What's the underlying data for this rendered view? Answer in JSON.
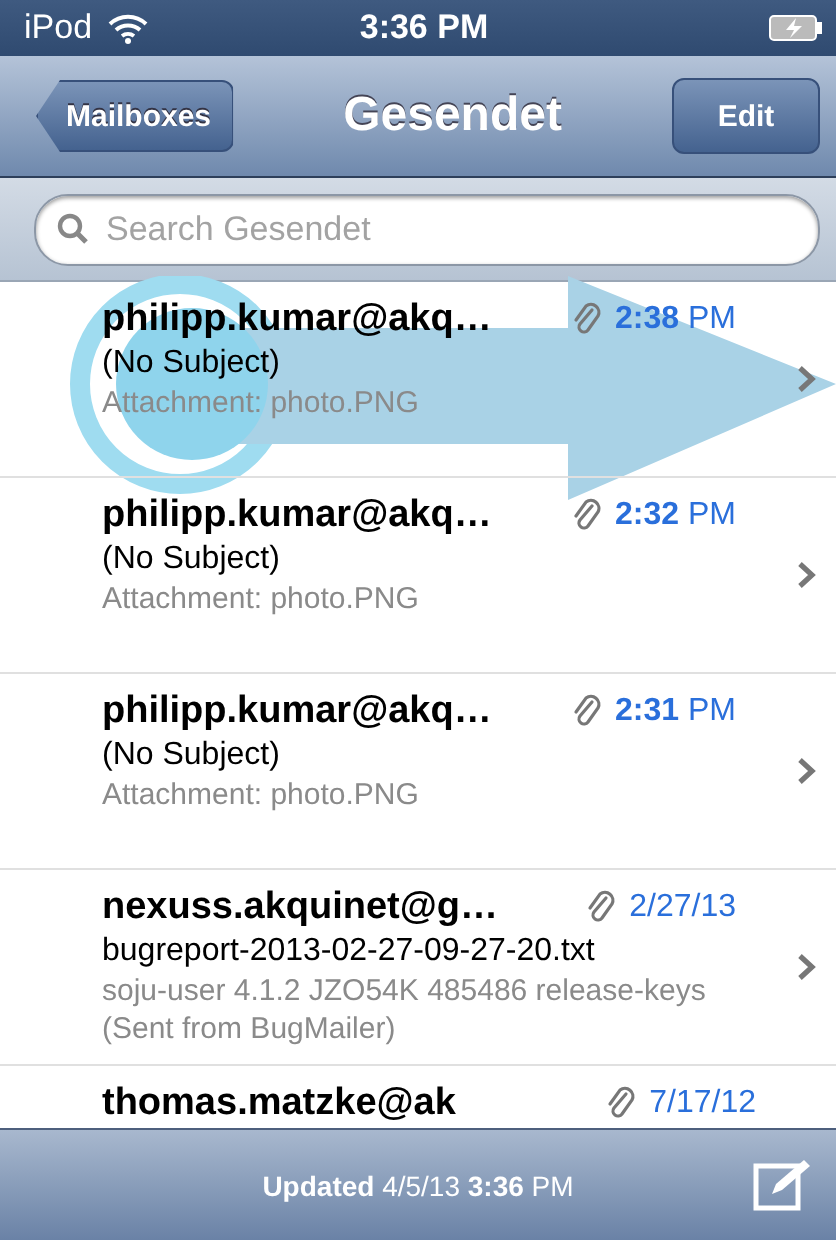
{
  "status_bar": {
    "carrier": "iPod",
    "time": "3:36 PM"
  },
  "nav_bar": {
    "back": "Mailboxes",
    "title": "Gesendet",
    "edit": "Edit"
  },
  "search": {
    "placeholder": "Search Gesendet"
  },
  "messages": [
    {
      "sender": "philipp.kumar@akq…",
      "attachment": true,
      "date": "**2:38** PM",
      "subject": "(No Subject)",
      "preview": "Attachment: photo.PNG"
    },
    {
      "sender": "philipp.kumar@akq…",
      "attachment": true,
      "date": "**2:32** PM",
      "subject": "(No Subject)",
      "preview": "Attachment: photo.PNG"
    },
    {
      "sender": "philipp.kumar@akq…",
      "attachment": true,
      "date": "**2:31** PM",
      "subject": "(No Subject)",
      "preview": "Attachment: photo.PNG"
    },
    {
      "sender": "nexuss.akquinet@g…",
      "attachment": true,
      "date": "2/27/13",
      "subject": "bugreport-2013-02-27-09-27-20.txt",
      "preview": "soju-user 4.1.2 JZO54K 485486 release-keys (Sent from BugMailer)"
    },
    {
      "sender": "thomas.matzke@ak",
      "attachment": true,
      "date": "7/17/12"
    }
  ],
  "toolbar": {
    "status": "**Updated** 4/5/13 **3:36** PM"
  }
}
